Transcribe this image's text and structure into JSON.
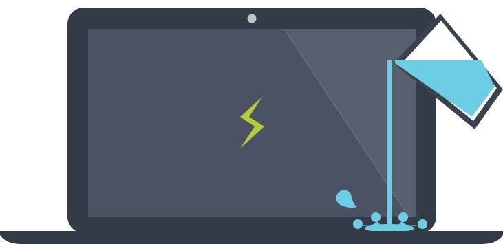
{
  "illustration": {
    "subject": "laptop-with-water-spill",
    "colors": {
      "background": "#ffffff",
      "laptop_body": "#333b47",
      "screen": "#4a5263",
      "screen_glare": "#5a6270",
      "camera": "#bfc3c8",
      "base": "#333b47",
      "lightning": "#b8c93a",
      "water": "#6ccde3",
      "glass_outline": "#3a424e"
    },
    "icons": {
      "screen_symbol": "lightning-bolt-icon",
      "container": "glass-icon",
      "liquid": "water-splash-icon"
    }
  }
}
